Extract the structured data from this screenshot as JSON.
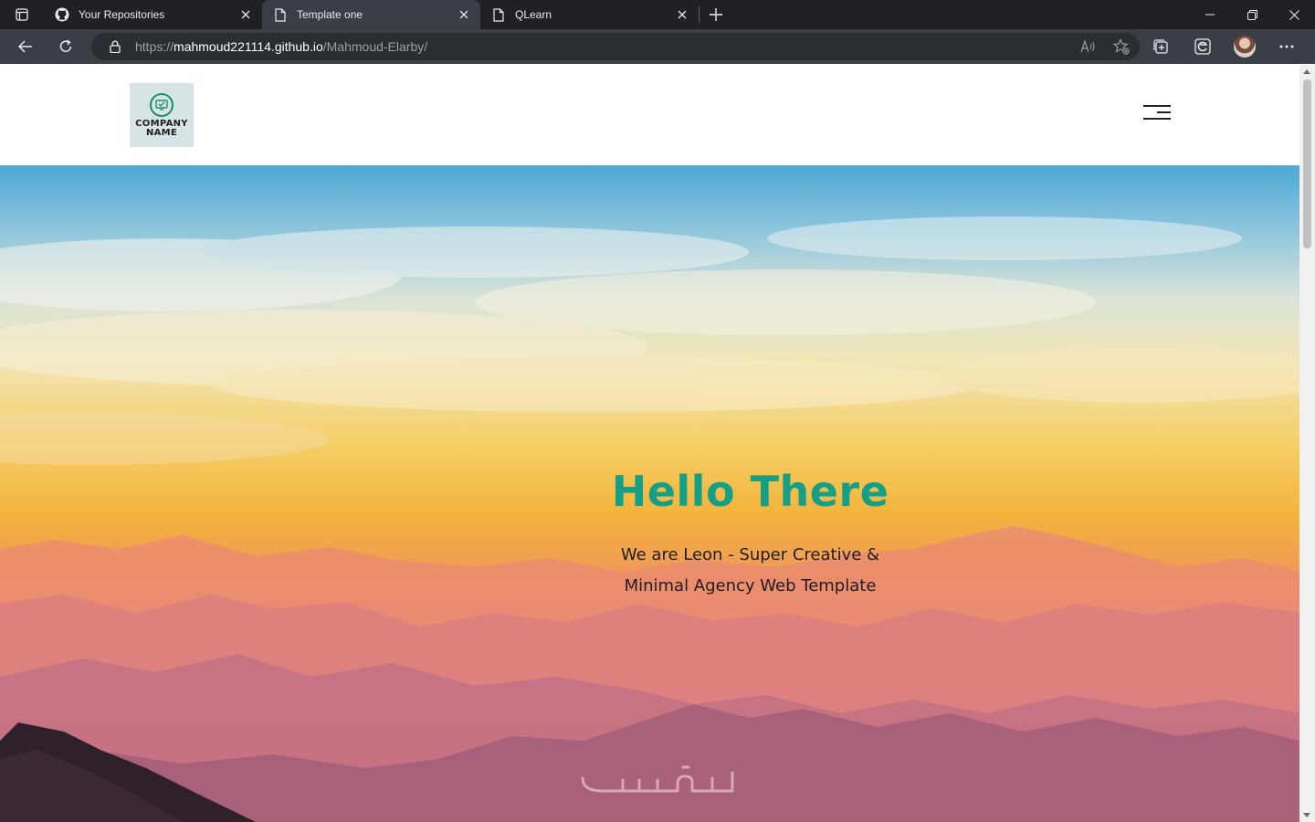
{
  "browser": {
    "tabs": [
      {
        "title": "Your Repositories",
        "icon": "github-icon",
        "active": false
      },
      {
        "title": "Template one",
        "icon": "page-icon",
        "active": true
      },
      {
        "title": "QLearn",
        "icon": "page-icon",
        "active": false
      }
    ],
    "address": {
      "scheme": "https://",
      "host": "mahmoud221114.github.io",
      "path": "/Mahmoud-Elarby/"
    }
  },
  "site": {
    "logo": {
      "line1": "COMPANY",
      "line2": "NAME"
    },
    "hero": {
      "title": "Hello There",
      "subtitle_line1": "We are Leon - Super Creative &",
      "subtitle_line2": "Minimal Agency Web Template"
    },
    "watermark": "خمسات"
  },
  "colors": {
    "accent": "#15a085",
    "chrome_dark": "#202124",
    "chrome_toolbar": "#3b3f45"
  }
}
